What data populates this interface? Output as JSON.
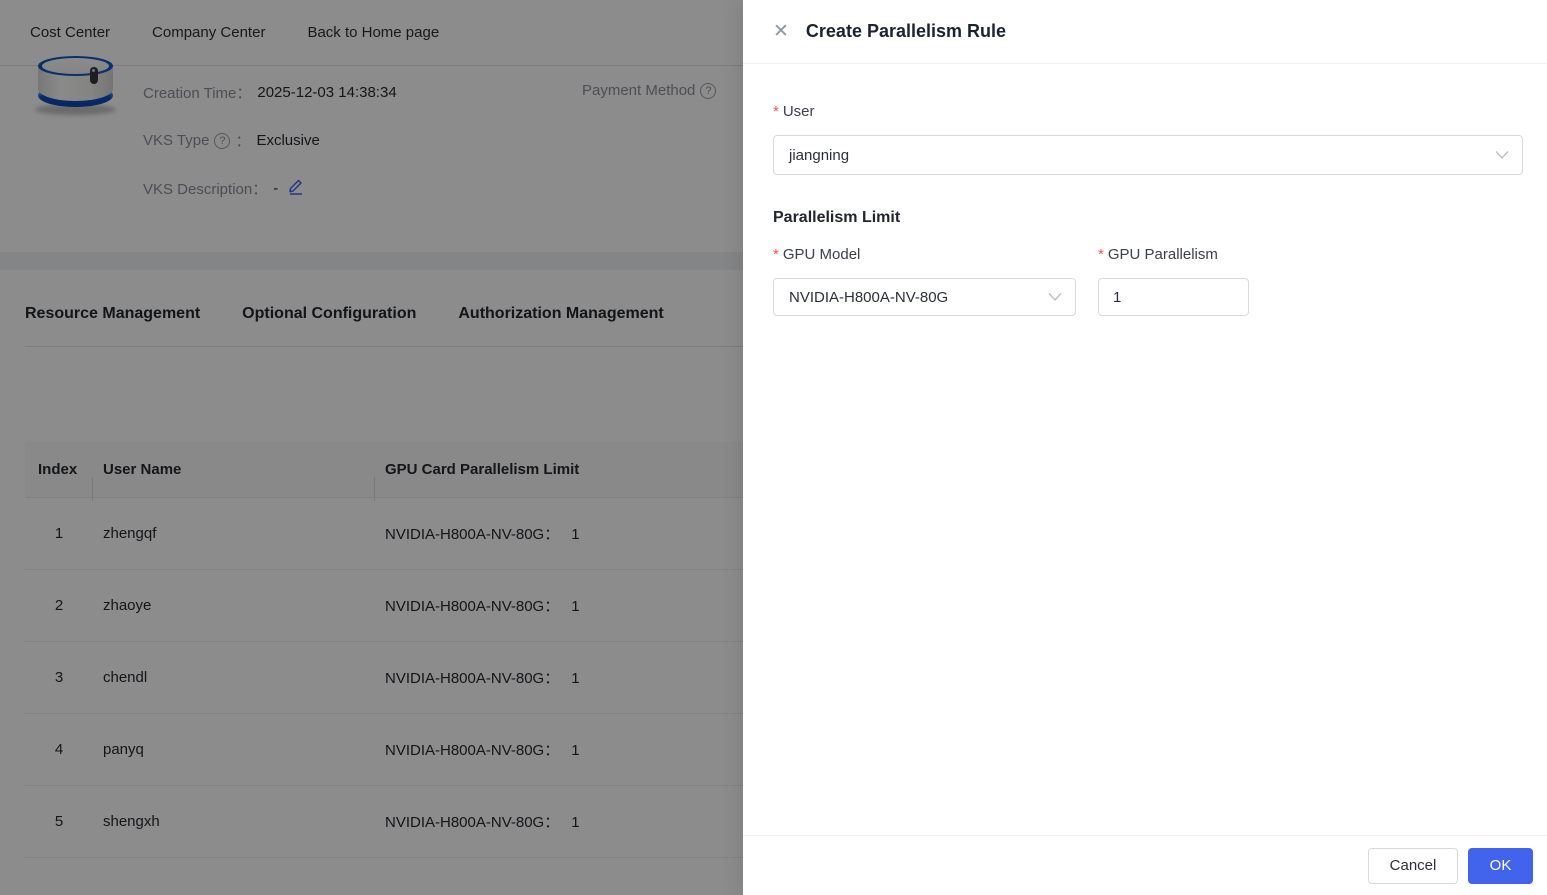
{
  "nav": {
    "items": [
      {
        "label": "Cost Center"
      },
      {
        "label": "Company Center"
      },
      {
        "label": "Back to Home page"
      }
    ]
  },
  "header_card": {
    "creation_time_label": "Creation Time：",
    "creation_time_value": "2025-12-03 14:38:34",
    "payment_method_label": "Payment Method",
    "vks_type_label": "VKS Type",
    "vks_type_separator": "：",
    "vks_type_value": "Exclusive",
    "vks_description_label": "VKS Description：",
    "vks_description_value": "-"
  },
  "tabs": [
    {
      "label": "Resource Management"
    },
    {
      "label": "Optional Configuration"
    },
    {
      "label": "Authorization Management"
    }
  ],
  "table": {
    "columns": {
      "index": "Index",
      "user": "User Name",
      "limit": "GPU Card Parallelism Limit"
    },
    "limit_separator": "：",
    "rows": [
      {
        "index": "1",
        "user": "zhengqf",
        "gpu_model": "NVIDIA-H800A-NV-80G",
        "limit": "1"
      },
      {
        "index": "2",
        "user": "zhaoye",
        "gpu_model": "NVIDIA-H800A-NV-80G",
        "limit": "1"
      },
      {
        "index": "3",
        "user": "chendl",
        "gpu_model": "NVIDIA-H800A-NV-80G",
        "limit": "1"
      },
      {
        "index": "4",
        "user": "panyq",
        "gpu_model": "NVIDIA-H800A-NV-80G",
        "limit": "1"
      },
      {
        "index": "5",
        "user": "shengxh",
        "gpu_model": "NVIDIA-H800A-NV-80G",
        "limit": "1"
      }
    ]
  },
  "drawer": {
    "title": "Create Parallelism Rule",
    "required_marker": "*",
    "user_label": "User",
    "user_value": "jiangning",
    "section_title": "Parallelism Limit",
    "gpu_model_label": "GPU Model",
    "gpu_model_value": "NVIDIA-H800A-NV-80G",
    "gpu_parallelism_label": "GPU Parallelism",
    "gpu_parallelism_value": "1",
    "cancel_label": "Cancel",
    "ok_label": "OK"
  },
  "icons": {
    "close": "✕",
    "help": "?"
  },
  "colors": {
    "primary": "#4263eb",
    "required": "#f5554a",
    "mask": "rgba(0,0,0,0.45)"
  }
}
